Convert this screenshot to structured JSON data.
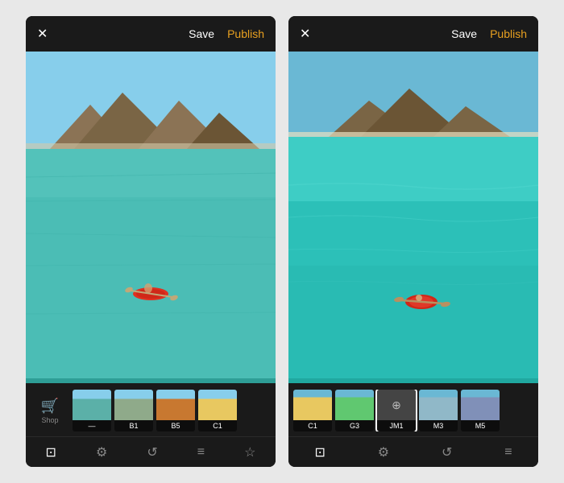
{
  "panels": [
    {
      "id": "left",
      "header": {
        "close_label": "✕",
        "save_label": "Save",
        "publish_label": "Publish"
      },
      "filter_shop_label": "Shop",
      "filters": [
        {
          "id": "none",
          "label": "—",
          "selected": false,
          "colorClass": "ft-none"
        },
        {
          "id": "b1",
          "label": "B1",
          "selected": false,
          "colorClass": "ft-b1"
        },
        {
          "id": "b5",
          "label": "B5",
          "selected": false,
          "colorClass": "ft-b5"
        },
        {
          "id": "c1",
          "label": "C1",
          "selected": false,
          "colorClass": "ft-c1"
        }
      ],
      "toolbar": {
        "icons": [
          "☰",
          "⊡",
          "↺",
          "≡",
          "☆"
        ]
      }
    },
    {
      "id": "right",
      "header": {
        "close_label": "✕",
        "save_label": "Save",
        "publish_label": "Publish"
      },
      "filters": [
        {
          "id": "c1",
          "label": "C1",
          "selected": false,
          "colorClass": "ft-c1-right"
        },
        {
          "id": "g3",
          "label": "G3",
          "selected": false,
          "colorClass": "ft-g3"
        },
        {
          "id": "jm1",
          "label": "JM1",
          "selected": true,
          "colorClass": "ft-jm1"
        },
        {
          "id": "m3",
          "label": "M3",
          "selected": false,
          "colorClass": "ft-m3"
        },
        {
          "id": "m5",
          "label": "M5",
          "selected": false,
          "colorClass": "ft-m5"
        }
      ],
      "toolbar": {
        "icons": [
          "⊡",
          "⊕",
          "↺",
          "≡"
        ]
      }
    }
  ],
  "colors": {
    "publish": "#e8a020",
    "save": "#ffffff",
    "background": "#1a1a1a",
    "text_inactive": "#888888"
  }
}
